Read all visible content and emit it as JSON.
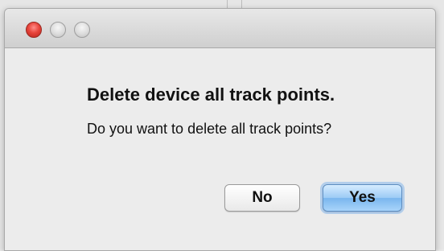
{
  "dialog": {
    "title": "Delete device all track points.",
    "message": "Do you want to delete all track points?",
    "buttons": {
      "no": "No",
      "yes": "Yes"
    }
  },
  "window_controls": {
    "close": "close-icon",
    "minimize": "minimize-icon",
    "zoom": "zoom-icon"
  },
  "colors": {
    "close": "#e8453c",
    "default_button": "#7ab6ee",
    "background": "#ececec"
  }
}
